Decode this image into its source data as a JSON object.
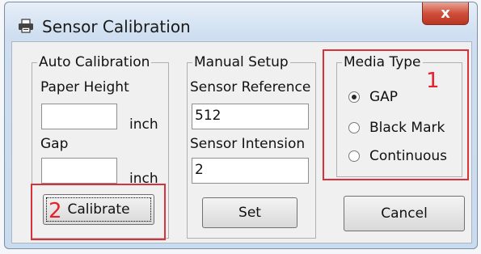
{
  "window": {
    "title": "Sensor Calibration",
    "close_glyph": "x"
  },
  "auto_calibration": {
    "legend": "Auto Calibration",
    "paper_height_label": "Paper Height",
    "paper_height_value": "",
    "paper_height_unit": "inch",
    "gap_label": "Gap",
    "gap_value": "",
    "gap_unit": "inch",
    "calibrate_label": "Calibrate"
  },
  "manual_setup": {
    "legend": "Manual Setup",
    "sensor_reference_label": "Sensor Reference",
    "sensor_reference_value": "512",
    "sensor_intension_label": "Sensor Intension",
    "sensor_intension_value": "2",
    "set_label": "Set"
  },
  "media_type": {
    "legend": "Media Type",
    "options": [
      {
        "label": "GAP",
        "selected": true
      },
      {
        "label": "Black Mark",
        "selected": false
      },
      {
        "label": "Continuous",
        "selected": false
      }
    ]
  },
  "cancel_label": "Cancel",
  "annotations": {
    "marker_1": "1",
    "marker_2": "2",
    "highlight_color": "#d7323a"
  }
}
